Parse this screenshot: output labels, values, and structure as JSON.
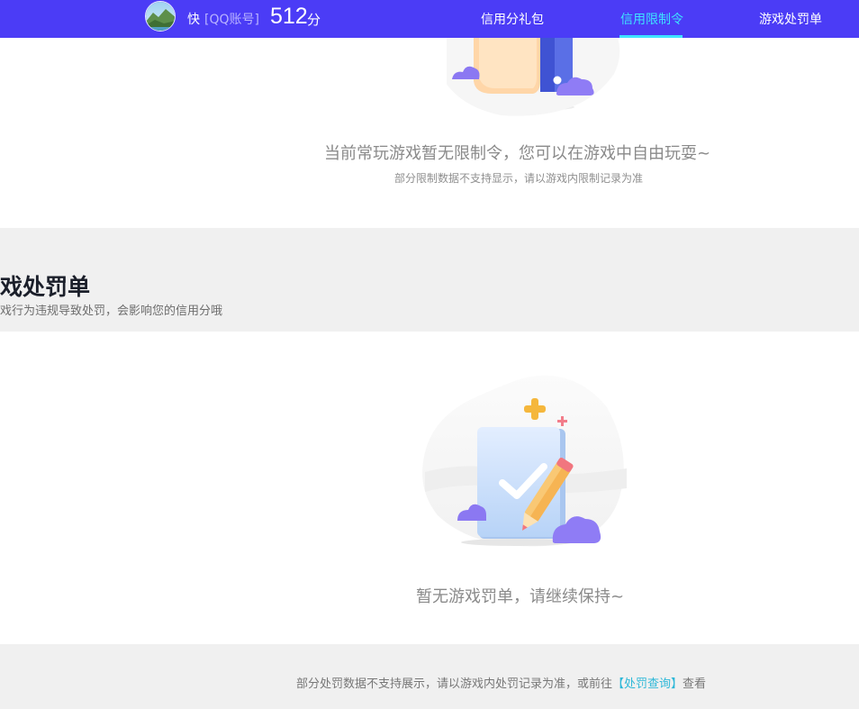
{
  "header": {
    "user_name": "快",
    "account_type": "[QQ账号]",
    "score": "512",
    "score_unit": "分",
    "nav": [
      {
        "label": "信用分礼包"
      },
      {
        "label": "信用限制令"
      },
      {
        "label": "游戏处罚单"
      }
    ],
    "active_color": "#3ee3ff",
    "bar_color": "#4b3cf6"
  },
  "restriction": {
    "empty_title": "当前常玩游戏暂无限制令，您可以在游戏中自由玩耍~",
    "note": "部分限制数据不支持显示，请以游戏内限制记录为准"
  },
  "penalty": {
    "title": "戏处罚单",
    "subtitle": "戏行为违规导致处罚，会影响您的信用分哦",
    "empty_title": "暂无游戏罚单，请继续保持~",
    "footer_prefix": "部分处罚数据不支持展示，请以游戏内处罚记录为准，或前往",
    "footer_link": "【处罚查询】",
    "footer_suffix": "查看"
  }
}
